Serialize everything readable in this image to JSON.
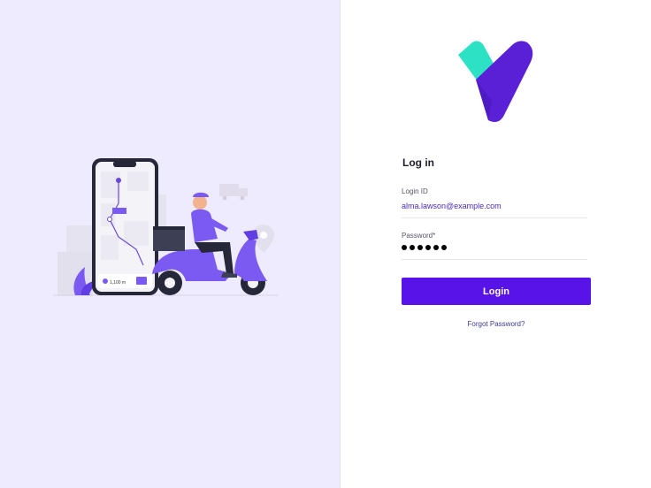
{
  "form": {
    "title": "Log in",
    "login_id_label": "Login ID",
    "login_id_value": "alma.lawson@example.com",
    "password_label": "Password*",
    "password_length": 6,
    "login_button": "Login",
    "forgot_link": "Forgot Password?"
  },
  "illustration": {
    "distance_label": "1,100 m",
    "route_badge": "Delivery"
  },
  "colors": {
    "accent": "#5814e8",
    "logo_teal": "#2de2c4",
    "logo_purple": "#5a20d6",
    "left_bg": "#efebff"
  }
}
